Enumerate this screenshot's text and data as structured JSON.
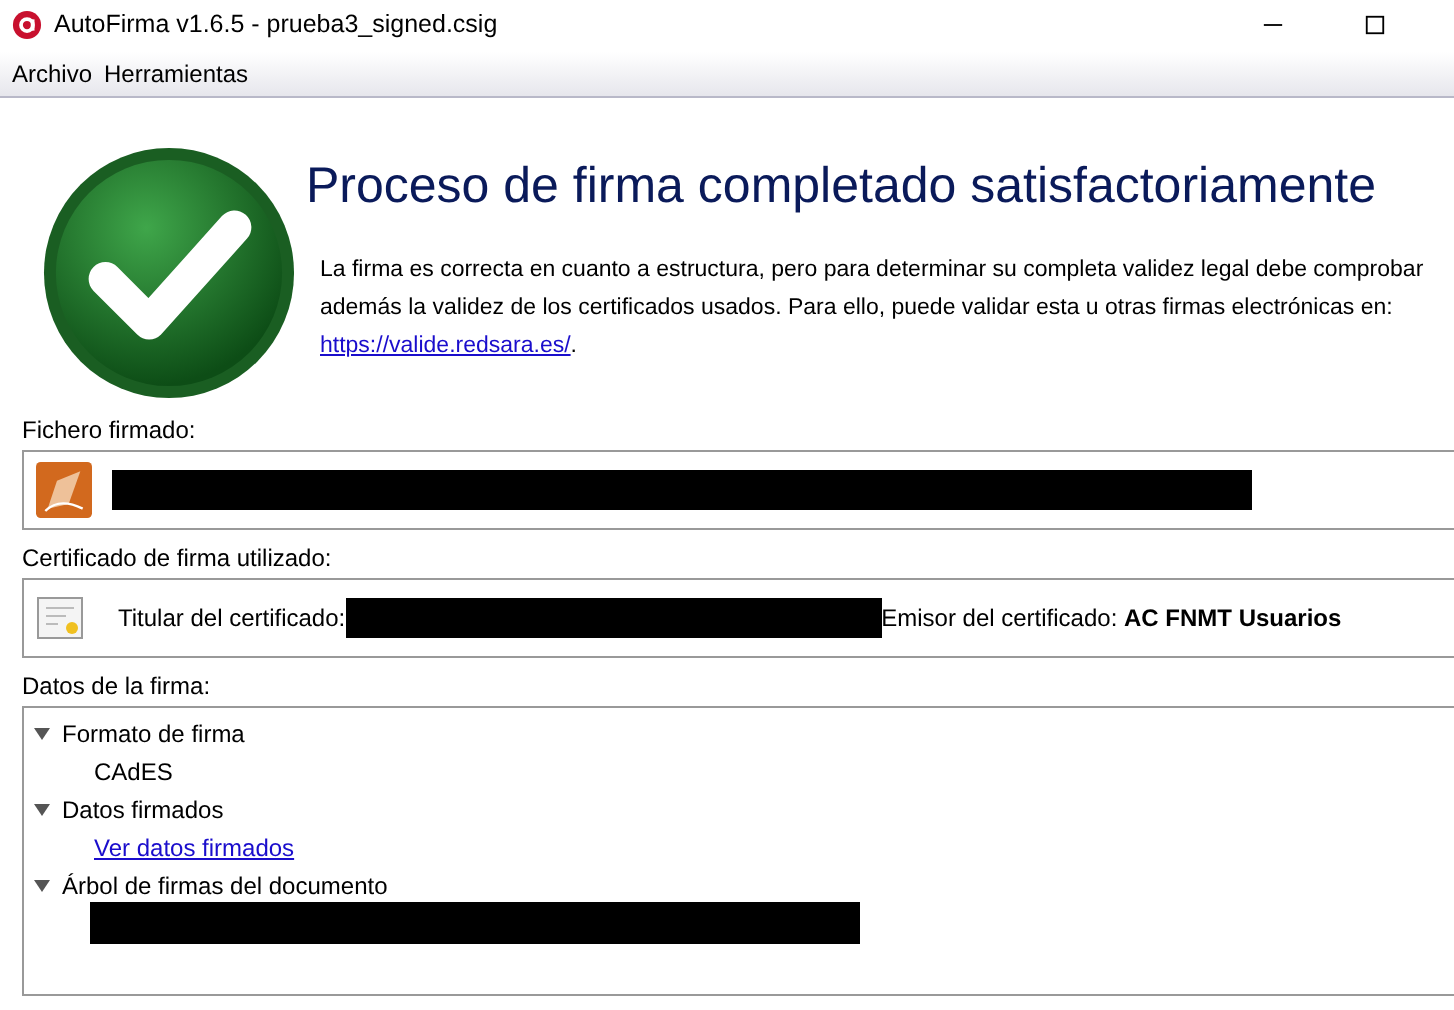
{
  "window": {
    "title": "AutoFirma v1.6.5 - prueba3_signed.csig"
  },
  "menu": [
    "Archivo",
    "Herramientas"
  ],
  "result": {
    "heading": "Proceso de firma completado satisfactoriamente",
    "message_before": "La firma es correcta en cuanto a estructura, pero para determinar su completa validez legal debe comprobar además la validez de los certificados usados. Para ello, puede validar esta u otras firmas electrónicas en: ",
    "link": "https://valide.redsara.es/",
    "message_after": "."
  },
  "signed_file": {
    "label": "Fichero firmado:"
  },
  "certificate": {
    "label": "Certificado de firma utilizado:",
    "holder_label": "Titular del certificado:",
    "issuer_label": "Emisor del certificado: ",
    "issuer": "AC FNMT Usuarios"
  },
  "signature_data": {
    "label": "Datos de la firma:",
    "tree": [
      {
        "label": "Formato de firma",
        "expanded": true,
        "children": [
          {
            "kind": "text",
            "label": "CAdES"
          }
        ]
      },
      {
        "label": "Datos firmados",
        "expanded": true,
        "children": [
          {
            "kind": "link",
            "label": "Ver datos firmados"
          }
        ]
      },
      {
        "label": "Árbol de firmas del documento",
        "expanded": true,
        "children": [
          {
            "kind": "redacted"
          }
        ]
      }
    ]
  }
}
